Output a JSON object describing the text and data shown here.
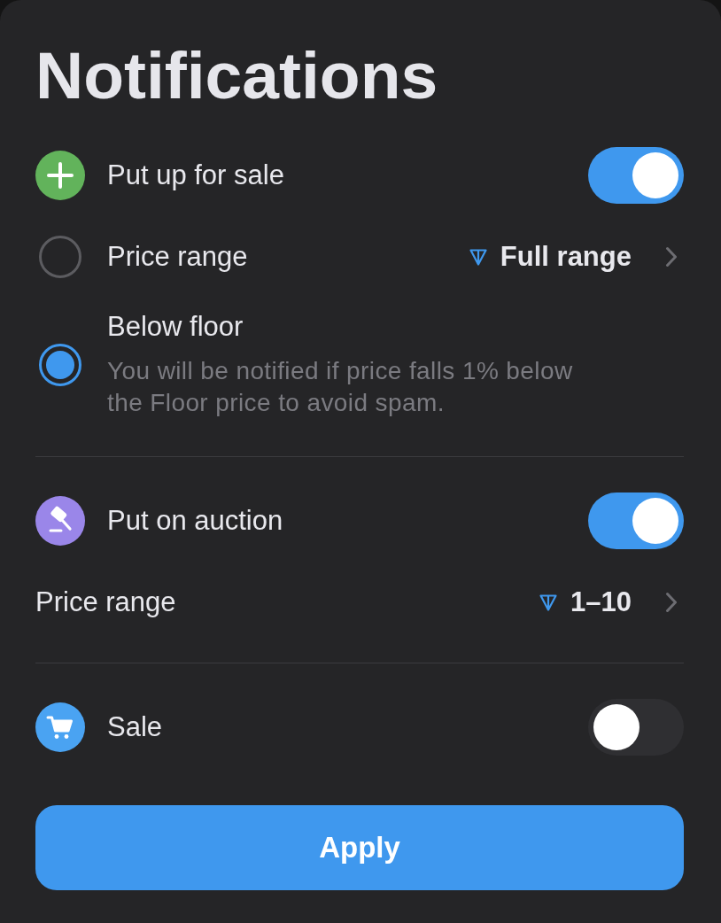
{
  "title": "Notifications",
  "sections": [
    {
      "label": "Put up for sale",
      "color": "#62b35b",
      "on": true,
      "options": [
        {
          "kind": "radio",
          "label": "Price range",
          "value": "Full range",
          "selected": false
        },
        {
          "kind": "radio",
          "label": "Below floor",
          "description": "You will be notified if price falls 1% below the Floor price to avoid spam.",
          "selected": true
        }
      ]
    },
    {
      "label": "Put on auction",
      "color": "#9a86e9",
      "on": true,
      "options": [
        {
          "kind": "setting",
          "label": "Price range",
          "value": "1–10"
        }
      ]
    },
    {
      "label": "Sale",
      "color": "#4aa3f2",
      "on": false
    }
  ],
  "apply_button": "Apply"
}
